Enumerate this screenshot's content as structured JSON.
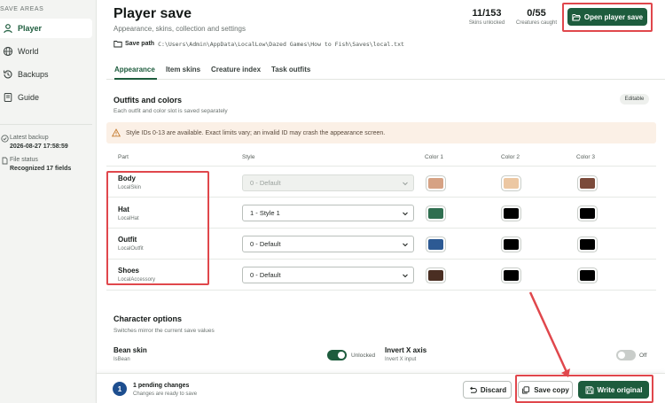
{
  "sidebar": {
    "section_title": "SAVE AREAS",
    "items": [
      {
        "label": "Player",
        "icon": "user-icon"
      },
      {
        "label": "World",
        "icon": "globe-icon"
      },
      {
        "label": "Backups",
        "icon": "backup-icon"
      },
      {
        "label": "Guide",
        "icon": "book-icon"
      }
    ],
    "latest_backup_label": "Latest backup",
    "latest_backup_value": "2026-08-27 17:58:59",
    "file_status_label": "File status",
    "file_status_value": "Recognized 17 fields"
  },
  "header": {
    "title": "Player save",
    "subtitle": "Appearance, skins, collection and settings",
    "save_path_label": "Save path",
    "save_path": "C:\\Users\\Admin\\AppData\\LocalLow\\Dazed Games\\How to Fish\\Saves\\local.txt",
    "stats": [
      {
        "value": "11/153",
        "caption": "Skins unlocked"
      },
      {
        "value": "0/55",
        "caption": "Creatures caught"
      }
    ],
    "open_button": "Open player save"
  },
  "tabs": [
    "Appearance",
    "Item skins",
    "Creature index",
    "Task outfits"
  ],
  "outfits": {
    "title": "Outfits and colors",
    "subtitle": "Each outfit and color slot is saved separately",
    "badge": "Editable",
    "warning": "Style IDs 0-13 are available. Exact limits vary; an invalid ID may crash the appearance screen.",
    "columns": [
      "Part",
      "Style",
      "Color 1",
      "Color 2",
      "Color 3"
    ],
    "rows": [
      {
        "name": "Body",
        "key": "LocalSkin",
        "style": "0 - Default",
        "disabled": true,
        "colors": [
          "#d6a284",
          "#ecc7a2",
          "#7b4a3a"
        ]
      },
      {
        "name": "Hat",
        "key": "LocalHat",
        "style": "1 - Style 1",
        "disabled": false,
        "colors": [
          "#2f6f50",
          "#000000",
          "#000000"
        ]
      },
      {
        "name": "Outfit",
        "key": "LocalOutfit",
        "style": "0 - Default",
        "disabled": false,
        "colors": [
          "#2d5a94",
          "#000000",
          "#000000"
        ]
      },
      {
        "name": "Shoes",
        "key": "LocalAccessory",
        "style": "0 - Default",
        "disabled": false,
        "colors": [
          "#4a2e22",
          "#000000",
          "#000000"
        ]
      }
    ]
  },
  "character_options": {
    "title": "Character options",
    "subtitle": "Switches mirror the current save values",
    "options": [
      {
        "name": "Bean skin",
        "key": "IsBean",
        "state": "Unlocked",
        "on": true
      },
      {
        "name": "Invert X axis",
        "key": "Invert X input",
        "state": "Off",
        "on": false
      }
    ]
  },
  "footer": {
    "pending_count": "1",
    "pending_title": "1 pending changes",
    "pending_sub": "Changes are ready to save",
    "discard": "Discard",
    "save_copy": "Save copy",
    "write_original": "Write original"
  },
  "colors": {
    "accent": "#1d5c3d",
    "highlight": "#e0474c",
    "warning_bg": "#fbf0e6",
    "pending_badge": "#1d4e8f"
  }
}
